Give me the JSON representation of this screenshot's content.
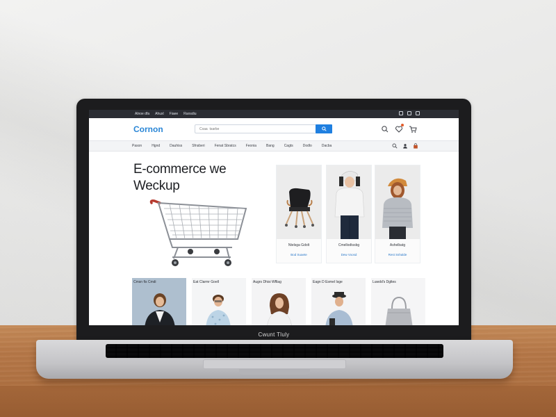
{
  "colors": {
    "brand": "#2a86d6",
    "search_button": "#1f7fe0",
    "topbar": "#2b2d33",
    "price": "#2a78c9",
    "notification": "#e25b2a"
  },
  "laptop": {
    "bezel_label": "Cwunt Tluly"
  },
  "site": {
    "topbar": {
      "links": [
        "Alnoe dfa",
        "Ahuxl",
        "Fiaee",
        "Ransdiu"
      ],
      "icons": [
        "grid-icon",
        "user-icon",
        "flag-icon"
      ]
    },
    "header": {
      "logo": "Cornon",
      "search_placeholder": "Cxaa  tsarbe",
      "icons": [
        "search-icon",
        "heart-icon",
        "cart-icon"
      ]
    },
    "nav": {
      "items": [
        "Pason",
        "Hgnd",
        "Dauhiss",
        "Sfnsberi",
        "Fenat Sbratcs",
        "Feonia",
        "Bang",
        "Cagts",
        "Dodlo",
        "Dacba"
      ],
      "tools": [
        "search-icon",
        "user-icon",
        "bag-icon"
      ]
    },
    "hero": {
      "title_line1": "E-commerce we",
      "title_line2": "Weckup"
    },
    "products": [
      {
        "name": "Ntelsga Gdolt",
        "price": "Bod  Suaete"
      },
      {
        "name": "Cmellodtssbg",
        "price": "Dew  Voosd"
      },
      {
        "name": "Ashelbatg",
        "price": "Rest  Sshalde"
      }
    ],
    "categories": [
      {
        "label": "Cmsn fis Cmdi"
      },
      {
        "label": "Eat Clarmr Goell"
      },
      {
        "label": "Augrs Dhisi Wfllag"
      },
      {
        "label": "Eagn D Esmel Isge"
      },
      {
        "label": "Luwdd's Dgltes"
      }
    ]
  }
}
